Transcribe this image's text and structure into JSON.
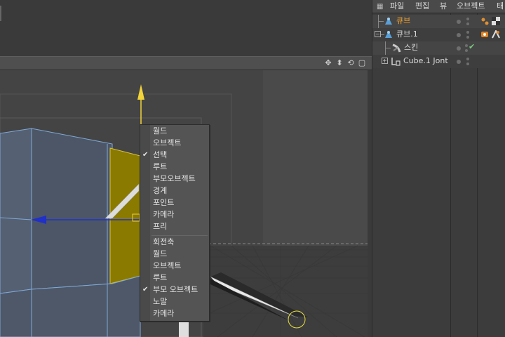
{
  "object_manager": {
    "menu": [
      "파일",
      "편집",
      "뷰",
      "오브젝트",
      "태"
    ],
    "objects": [
      {
        "name": "큐브",
        "highlighted": true
      },
      {
        "name": "큐브.1",
        "highlighted": false
      },
      {
        "name": "스킨",
        "highlighted": false
      },
      {
        "name": "Cube.1 Jont",
        "highlighted": false
      }
    ]
  },
  "viewport": {
    "header_icons": [
      "move-icon",
      "pan-icon",
      "rotate-icon",
      "maximize-icon"
    ]
  },
  "context_menu": {
    "items": [
      {
        "label": "월드",
        "checked": false
      },
      {
        "label": "오브젝트",
        "checked": false
      },
      {
        "label": "선택",
        "checked": true
      },
      {
        "label": "루트",
        "checked": false
      },
      {
        "label": "부모오브젝트",
        "checked": false
      },
      {
        "label": "경계",
        "checked": false
      },
      {
        "label": "포인트",
        "checked": false
      },
      {
        "label": "카메라",
        "checked": false
      },
      {
        "label": "프리",
        "checked": false
      }
    ],
    "items2": [
      {
        "label": "회전축",
        "checked": false
      },
      {
        "label": "월드",
        "checked": false
      },
      {
        "label": "오브젝트",
        "checked": false
      },
      {
        "label": "루트",
        "checked": false
      },
      {
        "label": "부모 오브젝트",
        "checked": true
      },
      {
        "label": "노말",
        "checked": false
      },
      {
        "label": "카메라",
        "checked": false
      }
    ]
  },
  "colors": {
    "highlight_text": "#f0a030",
    "selected_face": "#8a7a00",
    "y_axis": "#f2d33a",
    "x_axis": "#2030c8",
    "check_green": "#7dc67d"
  }
}
